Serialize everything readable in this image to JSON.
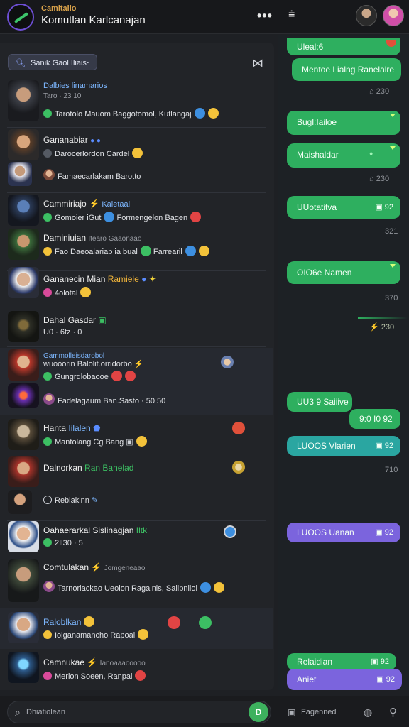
{
  "header": {
    "subtitle": "Camitaiio",
    "title": "Komutlan Karlcanajan",
    "more_icon": "more-dots-icon",
    "adjust_icon": "adjust-icon"
  },
  "filter": {
    "label": "Sanik Gaol Iliais",
    "icon": "search-icon",
    "chevron": "chevron-down-icon"
  },
  "chats": [
    {
      "name": "Dalbies linamarios",
      "time": "Taro · 23 10",
      "preview": "Tarotolo Mauom Baggotomol, Kutlangaj"
    },
    {
      "name": "Gananabiar",
      "preview": "Darocerlordon Cardel"
    },
    {
      "preview": "Famaecarlakam Barotto"
    },
    {
      "name": "Cammiriajo",
      "tag": "Kaletaal",
      "preview": "Gomoier iGut",
      "preview2": "Formengelon Bagen"
    },
    {
      "name": "Daminiuian",
      "time": "Itearo Gaaonaao",
      "preview": "Fao Daeoalariab ia bual",
      "preview2": "Farrearil"
    },
    {
      "name": "Gananecin Mian",
      "tag": "Ramiele",
      "preview": "4olotal"
    },
    {
      "name": "Dahal Gasdar",
      "preview": "U0 · 6tz · 0"
    },
    {
      "name": "Gammolleisdarobol",
      "preview": "wuooorin Balolit.orridorbo",
      "preview2": "Gungrdlobaooe"
    },
    {
      "preview": "Fadelagaum Ban.Sasto · 50.50"
    },
    {
      "name": "Hanta",
      "tag": "Iilalen",
      "preview": "Mantolang Cg Bang"
    },
    {
      "name": "Dalnorkan",
      "tag": "Ran Banelad",
      "preview": "Rebiakinn"
    },
    {
      "name": "Oahaerarkal Sislinagjan",
      "tag": "Iltk",
      "preview": "2Il30 · 5"
    },
    {
      "name": "Comtulakan",
      "time": "Jomgeneaao",
      "preview": "Tarnorlackao Ueolon Ragalnis, Salipniiol"
    },
    {
      "name": "Raloblkan",
      "preview": "Iolganamancho Rapoal"
    },
    {
      "name": "Camnukae",
      "time": "Ianoaaaooooo",
      "preview": "Merlon Soeen, Ranpal"
    }
  ],
  "right": {
    "bubbles": [
      {
        "text": "Uleal:6",
        "meta": ""
      },
      {
        "text": "Mentoe Lialng Ranelalre",
        "meta": ""
      },
      {
        "text": "Bugl:Iailoe",
        "meta": ""
      },
      {
        "text": "Maishaldar",
        "meta": ""
      },
      {
        "text": "UUotatitva",
        "meta": "92"
      },
      {
        "text": "OIO6e Namen",
        "meta": ""
      },
      {
        "text": "UU3 9 Saiiive",
        "meta": ""
      },
      {
        "text": "9:0 I0 92",
        "meta": ""
      },
      {
        "text": "LUOOS Vlarien",
        "meta": "92"
      },
      {
        "text": "LUOOS Uanan",
        "meta": "92"
      },
      {
        "text": "Relaidian",
        "meta": "92"
      },
      {
        "text": "Aniet",
        "meta": "92"
      }
    ],
    "reads": [
      "230",
      "230",
      "321",
      "370",
      "230",
      "710"
    ]
  },
  "bottom": {
    "placeholder": "Dhiatiolean",
    "send_label": "D",
    "label": "Fagenned"
  }
}
